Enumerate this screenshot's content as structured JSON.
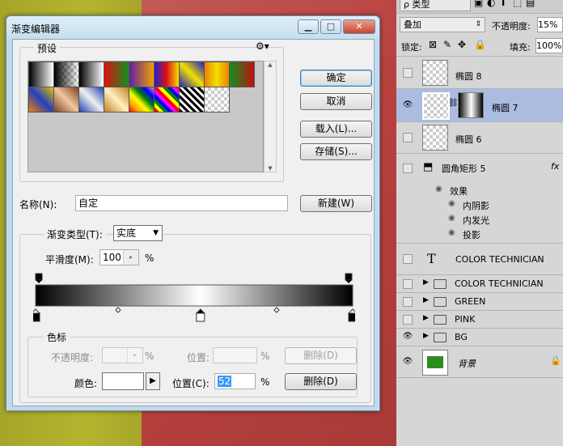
{
  "dialog": {
    "title": "渐变编辑器",
    "presets": {
      "label": "预设"
    },
    "buttons": {
      "ok": "确定",
      "cancel": "取消",
      "load": "载入(L)...",
      "save": "存储(S)...",
      "new": "新建(W)"
    },
    "name": {
      "label": "名称(N):",
      "value": "自定"
    },
    "gradient_type": {
      "label": "渐变类型(T):",
      "value": "实底"
    },
    "smoothness": {
      "label": "平滑度(M):",
      "value": "100",
      "unit": "%"
    },
    "stops": {
      "label": "色标",
      "opacity_label": "不透明度:",
      "opacity_unit": "%",
      "position_label_disabled": "位置:",
      "position_unit_disabled": "%",
      "delete_disabled": "删除(D)",
      "color_label": "颜色:",
      "position_label": "位置(C):",
      "position_value": "52",
      "position_unit": "%",
      "delete": "删除(D)",
      "color_stop_positions": [
        0,
        52,
        100
      ],
      "midpoint_positions": [
        26,
        76
      ]
    }
  },
  "layers_panel": {
    "filter_kind": "类型",
    "blend_mode": "叠加",
    "opacity_label": "不透明度:",
    "opacity_value": "15%",
    "lock_label": "锁定:",
    "fill_label": "填充:",
    "fill_value": "100%",
    "layers": [
      {
        "name": "椭圆 8"
      },
      {
        "name": "椭圆 7"
      },
      {
        "name": "椭圆 6"
      },
      {
        "name": "圆角矩形 5"
      },
      {
        "effects_label": "效果"
      },
      {
        "effect": "内阴影"
      },
      {
        "effect": "内发光"
      },
      {
        "effect": "投影"
      },
      {
        "name": "COLOR TECHNICIAN"
      },
      {
        "name": "COLOR TECHNICIAN"
      },
      {
        "name": "GREEN"
      },
      {
        "name": "PINK"
      },
      {
        "name": "BG"
      },
      {
        "name": "背景"
      }
    ],
    "fx_label": "fx"
  },
  "colors": {
    "accent_selection": "#aabde0",
    "background_layer_fill": "#2e8b1e"
  }
}
